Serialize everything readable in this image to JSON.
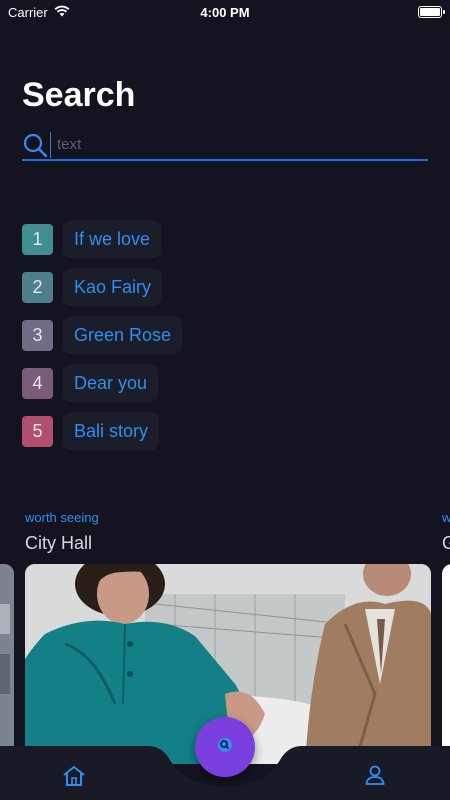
{
  "status_bar": {
    "carrier": "Carrier",
    "time": "4:00 PM"
  },
  "page": {
    "title": "Search"
  },
  "search": {
    "placeholder": "text",
    "value": ""
  },
  "ranking": [
    {
      "rank": "1",
      "label": "If we love",
      "color": "#3e8e92"
    },
    {
      "rank": "2",
      "label": "Kao Fairy",
      "color": "#4f7f8c"
    },
    {
      "rank": "3",
      "label": "Green Rose",
      "color": "#6e6c86"
    },
    {
      "rank": "4",
      "label": "Dear you",
      "color": "#7a5c78"
    },
    {
      "rank": "5",
      "label": "Bali story",
      "color": "#b14f6e"
    }
  ],
  "cards": [
    {
      "label": "worth seeing",
      "title": "City Hall"
    },
    {
      "label": "w",
      "title": "G"
    }
  ],
  "colors": {
    "background": "#13141f",
    "accent": "#2f8cf0",
    "fab": "#7b3fe0",
    "chip": "#1b1d2a"
  },
  "tabbar": {
    "items": [
      {
        "icon": "home-icon"
      },
      {
        "icon": "search-icon"
      },
      {
        "icon": "user-icon"
      }
    ]
  }
}
